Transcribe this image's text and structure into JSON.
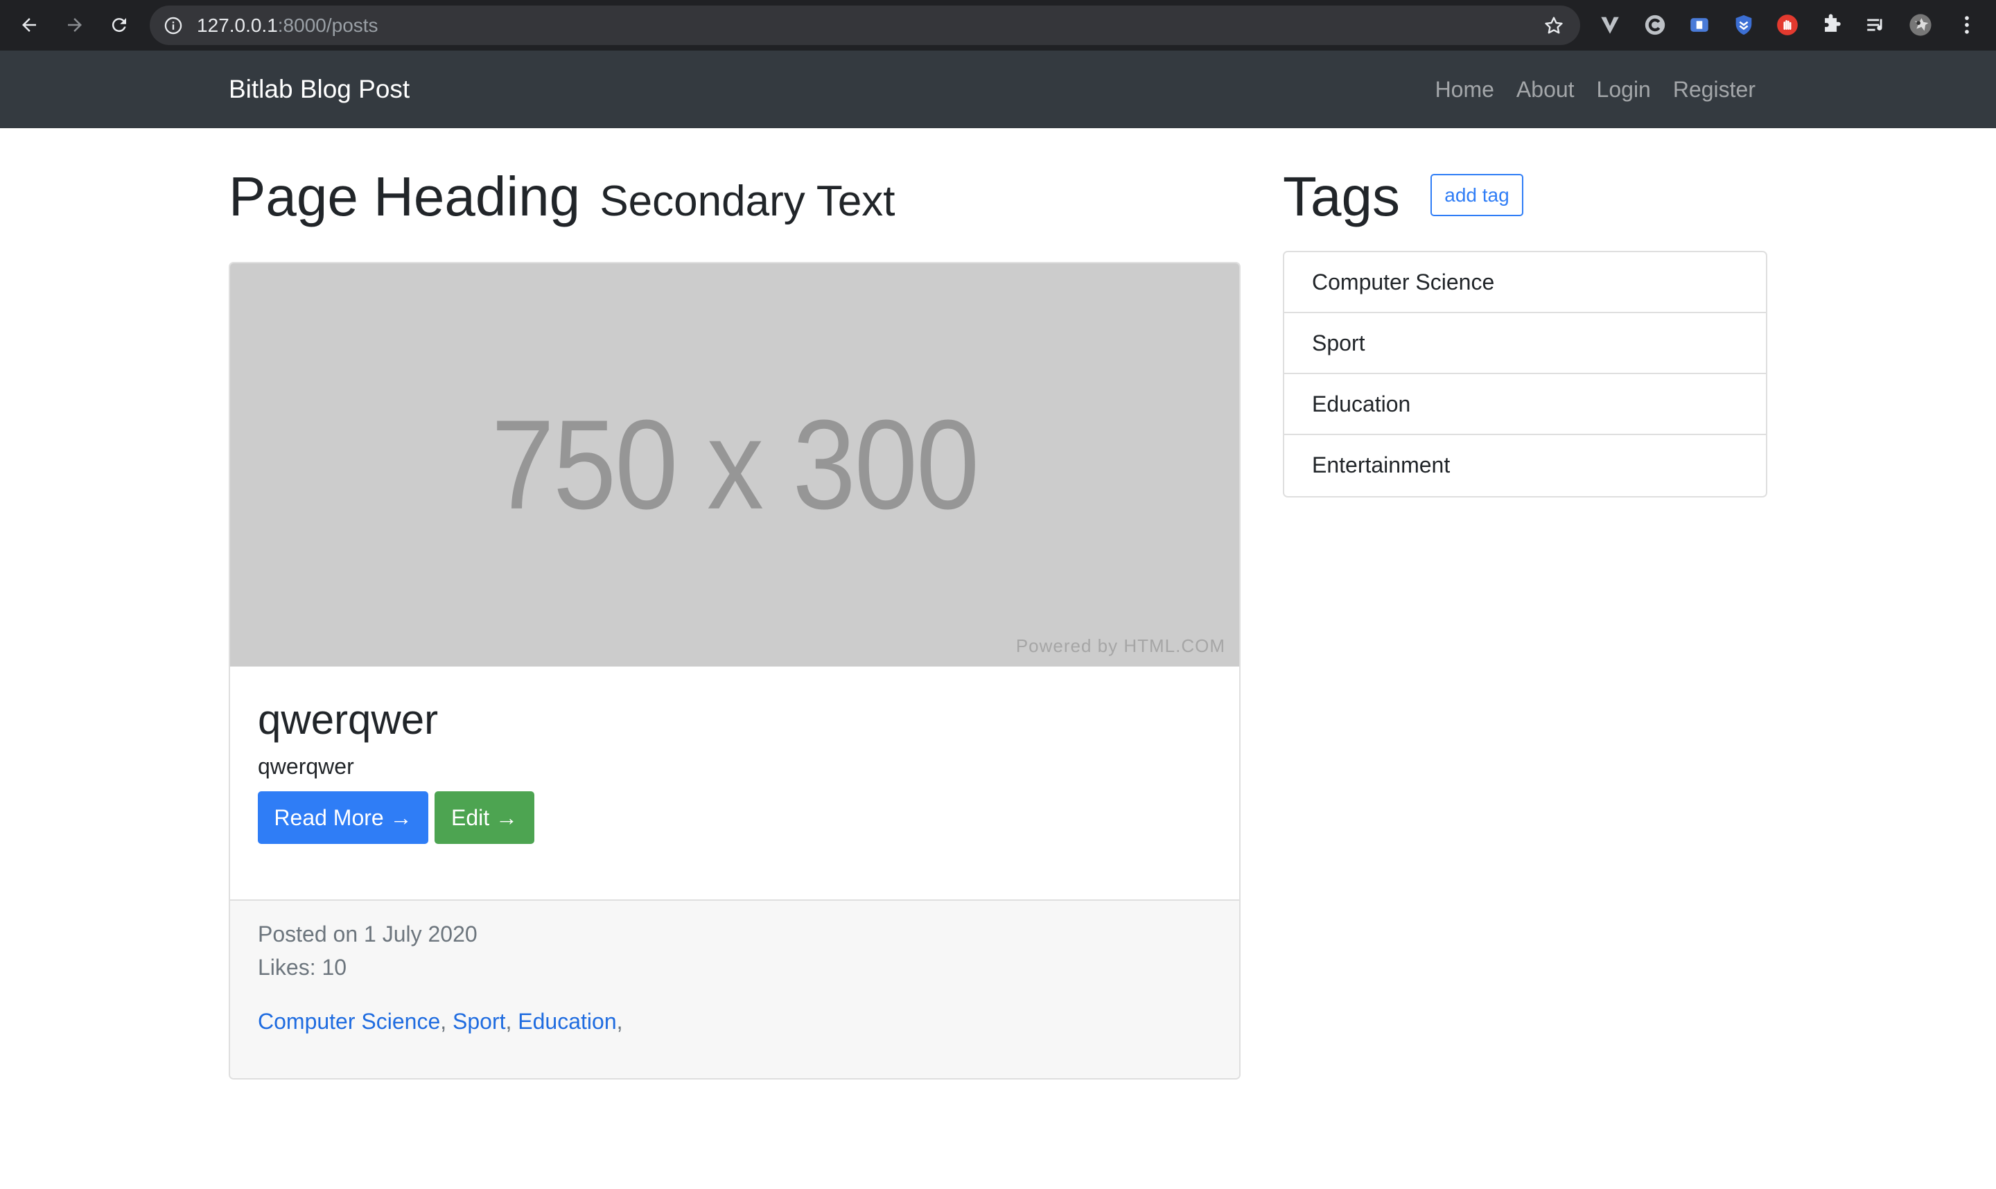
{
  "browser": {
    "url_host": "127.0.0.1",
    "url_path": ":8000/posts"
  },
  "navbar": {
    "brand": "Bitlab Blog Post",
    "links": [
      "Home",
      "About",
      "Login",
      "Register"
    ]
  },
  "heading": {
    "title": "Page Heading",
    "subtitle": "Secondary Text"
  },
  "post": {
    "image_placeholder": "750 x 300",
    "image_credit": "Powered by HTML.COM",
    "title": "qwerqwer",
    "text": "qwerqwer",
    "read_more_label": "Read More →",
    "edit_label": "Edit →",
    "posted_on": "Posted on 1 July 2020",
    "likes": "Likes: 10",
    "tags": [
      "Computer Science",
      "Sport",
      "Education"
    ]
  },
  "sidebar": {
    "title": "Tags",
    "add_tag_label": "add tag",
    "tags": [
      "Computer Science",
      "Sport",
      "Education",
      "Entertainment"
    ]
  },
  "colors": {
    "navbar_bg": "#343a40",
    "primary": "#2f7df6",
    "success": "#4da451",
    "link": "#1f6ce0"
  }
}
